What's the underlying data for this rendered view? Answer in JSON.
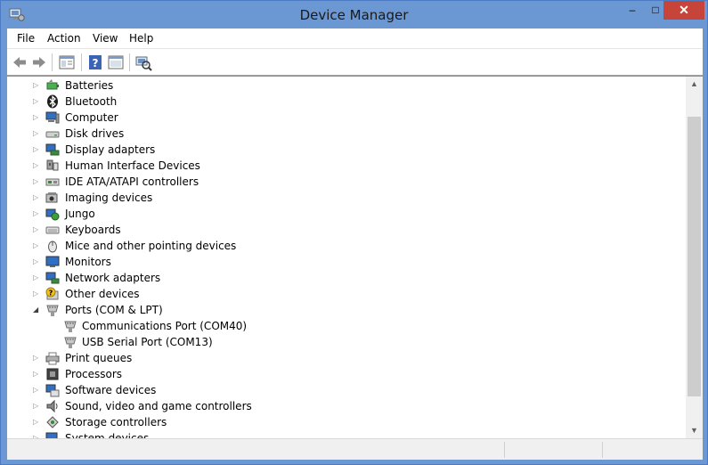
{
  "window": {
    "title": "Device Manager",
    "minimize": "–",
    "maximize": "□",
    "close": "✕"
  },
  "menu": [
    "File",
    "Action",
    "View",
    "Help"
  ],
  "toolbar": [
    "back-icon",
    "forward-icon",
    "properties-icon",
    "help-icon",
    "show-hidden-icon",
    "scan-hardware-icon"
  ],
  "tree": [
    {
      "label": "Batteries",
      "icon": "battery-icon",
      "state": "collapsed"
    },
    {
      "label": "Bluetooth",
      "icon": "bluetooth-icon",
      "state": "collapsed"
    },
    {
      "label": "Computer",
      "icon": "computer-icon",
      "state": "collapsed"
    },
    {
      "label": "Disk drives",
      "icon": "disk-drive-icon",
      "state": "collapsed"
    },
    {
      "label": "Display adapters",
      "icon": "display-adapter-icon",
      "state": "collapsed"
    },
    {
      "label": "Human Interface Devices",
      "icon": "hid-icon",
      "state": "collapsed"
    },
    {
      "label": "IDE ATA/ATAPI controllers",
      "icon": "ide-controller-icon",
      "state": "collapsed"
    },
    {
      "label": "Imaging devices",
      "icon": "camera-icon",
      "state": "collapsed"
    },
    {
      "label": "Jungo",
      "icon": "jungo-icon",
      "state": "collapsed"
    },
    {
      "label": "Keyboards",
      "icon": "keyboard-icon",
      "state": "collapsed"
    },
    {
      "label": "Mice and other pointing devices",
      "icon": "mouse-icon",
      "state": "collapsed"
    },
    {
      "label": "Monitors",
      "icon": "monitor-icon",
      "state": "collapsed"
    },
    {
      "label": "Network adapters",
      "icon": "network-adapter-icon",
      "state": "collapsed"
    },
    {
      "label": "Other devices",
      "icon": "unknown-device-icon",
      "state": "collapsed"
    },
    {
      "label": "Ports (COM & LPT)",
      "icon": "port-icon",
      "state": "expanded"
    },
    {
      "label": "Communications Port (COM40)",
      "icon": "port-icon",
      "state": "child"
    },
    {
      "label": "USB Serial Port (COM13)",
      "icon": "port-icon",
      "state": "child"
    },
    {
      "label": "Print queues",
      "icon": "printer-icon",
      "state": "collapsed"
    },
    {
      "label": "Processors",
      "icon": "processor-icon",
      "state": "collapsed"
    },
    {
      "label": "Software devices",
      "icon": "software-device-icon",
      "state": "collapsed"
    },
    {
      "label": "Sound, video and game controllers",
      "icon": "speaker-icon",
      "state": "collapsed"
    },
    {
      "label": "Storage controllers",
      "icon": "storage-controller-icon",
      "state": "collapsed"
    },
    {
      "label": "System devices",
      "icon": "system-device-icon",
      "state": "collapsed"
    }
  ],
  "colors": {
    "frame": "#6b97d3",
    "close": "#c7443a",
    "scrollbar": "#f0f0f0",
    "thumb": "#cdcdcd"
  }
}
